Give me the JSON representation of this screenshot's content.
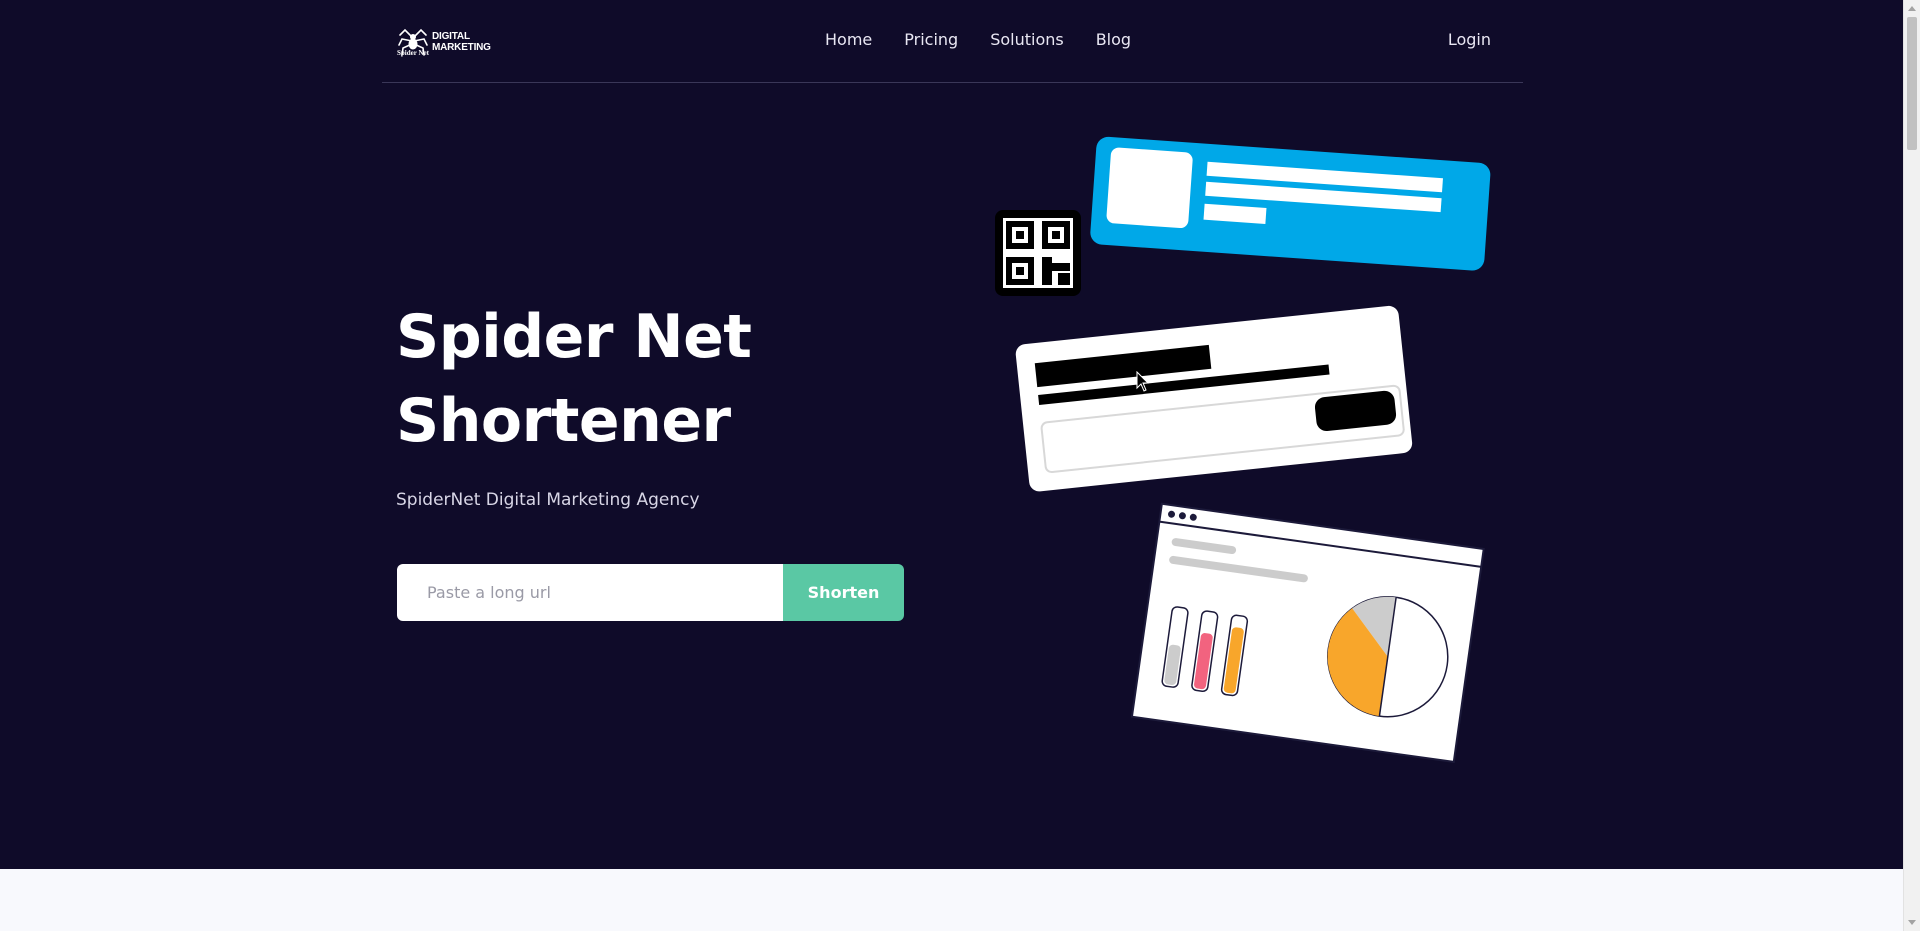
{
  "header": {
    "logo": {
      "line1": "DIGITAL",
      "line2": "MARKETING",
      "sub": "Spider Net"
    },
    "nav": [
      {
        "label": "Home"
      },
      {
        "label": "Pricing"
      },
      {
        "label": "Solutions"
      },
      {
        "label": "Blog"
      }
    ],
    "login_label": "Login"
  },
  "hero": {
    "title_line1": "Spider Net",
    "title_line2": "Shortener",
    "subtitle": "SpiderNet Digital Marketing Agency",
    "input_placeholder": "Paste a long url",
    "input_value": "",
    "button_label": "Shorten"
  },
  "colors": {
    "background": "#0f0b29",
    "accent_green": "#5ac8a4",
    "card_blue": "#00a8e8",
    "chart_orange": "#f8a62b",
    "chart_pink": "#f2637f",
    "lower_section": "#f8f9fd"
  }
}
